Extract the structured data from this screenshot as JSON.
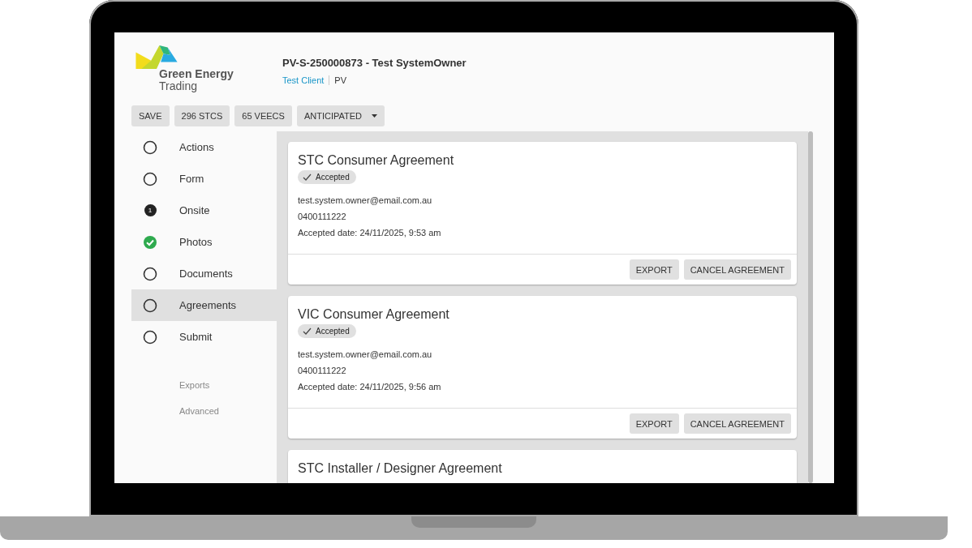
{
  "logo": {
    "line_1": "Green Energy",
    "line_2": "Trading"
  },
  "header": {
    "title": "PV-S-250000873 - Test SystemOwner",
    "client_link": "Test Client",
    "type": "PV"
  },
  "toolbar": [
    {
      "label": "SAVE",
      "kind": "button"
    },
    {
      "label": "296 STCS",
      "kind": "button"
    },
    {
      "label": "65 VEECS",
      "kind": "button"
    },
    {
      "label": "ANTICIPATED",
      "kind": "dropdown"
    }
  ],
  "steps": [
    {
      "label": "Actions",
      "kind": "empty",
      "selected": false
    },
    {
      "label": "Form",
      "kind": "empty",
      "selected": false
    },
    {
      "label": "Onsite",
      "kind": "count",
      "count": "1",
      "selected": false
    },
    {
      "label": "Photos",
      "kind": "done",
      "selected": false
    },
    {
      "label": "Documents",
      "kind": "empty",
      "selected": false
    },
    {
      "label": "Agreements",
      "kind": "empty",
      "selected": true
    },
    {
      "label": "Submit",
      "kind": "empty",
      "selected": false
    }
  ],
  "secondary_links": [
    "Exports",
    "Advanced"
  ],
  "agreements": [
    {
      "title": "STC Consumer Agreement",
      "status": "Accepted",
      "email": "test.system.owner@email.com.au",
      "phone": "0400111222",
      "accepted_date": "Accepted date: 24/11/2025, 9:53 am",
      "buttons": [
        "EXPORT",
        "CANCEL AGREEMENT"
      ]
    },
    {
      "title": "VIC Consumer Agreement",
      "status": "Accepted",
      "email": "test.system.owner@email.com.au",
      "phone": "0400111222",
      "accepted_date": "Accepted date: 24/11/2025, 9:56 am",
      "buttons": [
        "EXPORT",
        "CANCEL AGREEMENT"
      ]
    },
    {
      "title": "STC Installer / Designer Agreement"
    }
  ]
}
